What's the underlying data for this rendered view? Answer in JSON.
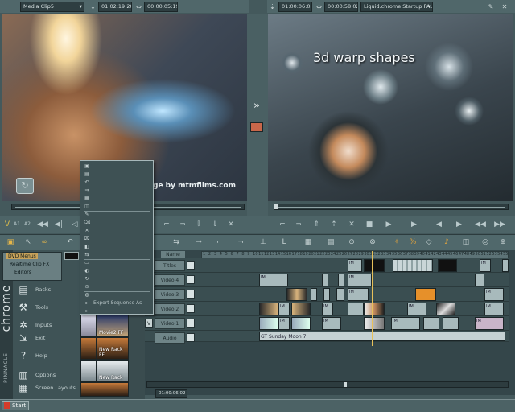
{
  "left_header": {
    "source_name": "Media Clip5",
    "timecode_in": "01:02:19:20",
    "duration": "00:00:05:19"
  },
  "right_header": {
    "timecode_in": "01:00:06:02",
    "duration": "00:00:58:02",
    "project_name": "Liquid.chrome Startup PAL"
  },
  "source_viewer": {
    "watermark": "footage by mtmfilms.com",
    "watermark_visible": "tage by mtmfilms.com"
  },
  "record_viewer": {
    "overlay_title": "3d warp shapes"
  },
  "context_menu": {
    "items": [
      "",
      "",
      "",
      "",
      "",
      "",
      "",
      "",
      "",
      "",
      "",
      "",
      "",
      "",
      "",
      "",
      "",
      "Export Sequence As",
      ""
    ]
  },
  "start_menu": {
    "brand_vertical": "chrome",
    "brand_bottom": "PINNACLE",
    "tree_items": [
      "DVD Menus",
      "Realtime Clip FX",
      "Editors"
    ],
    "items": [
      "Racks",
      "Tools",
      "Inputs",
      "Exit",
      "Help",
      "Options",
      "Screen Layouts",
      ""
    ]
  },
  "rack_thumbs": [
    {
      "label": "Movie2 FF"
    },
    {
      "label": "New Rack FF"
    },
    {
      "label": "New Rack"
    },
    {
      "label": ""
    }
  ],
  "timeline": {
    "tracks": [
      "Titles",
      "Video 4",
      "Video 3",
      "Video 2",
      "Video 1",
      "Audio"
    ],
    "name_header": "Name",
    "ruler": [
      "1",
      "2",
      "3",
      "4",
      "5",
      "6",
      "7",
      "8",
      "9",
      "10",
      "11",
      "12",
      "13",
      "14",
      "15",
      "16",
      "17",
      "18",
      "19",
      "20",
      "21",
      "22",
      "23",
      "24",
      "25",
      "26",
      "27",
      "28",
      "29",
      "30",
      "31",
      "32",
      "33",
      "34",
      "35",
      "36",
      "37",
      "38",
      "39",
      "40",
      "41",
      "42",
      "43",
      "44",
      "45",
      "46",
      "47",
      "48",
      "49",
      "50",
      "51",
      "52",
      "53",
      "54",
      "55"
    ],
    "audio_clip": "GT Sunday Moon 7",
    "position_timecode": "01:00:06:02",
    "clip_tag": "IM"
  },
  "taskbar": {
    "start_label": "Start"
  }
}
